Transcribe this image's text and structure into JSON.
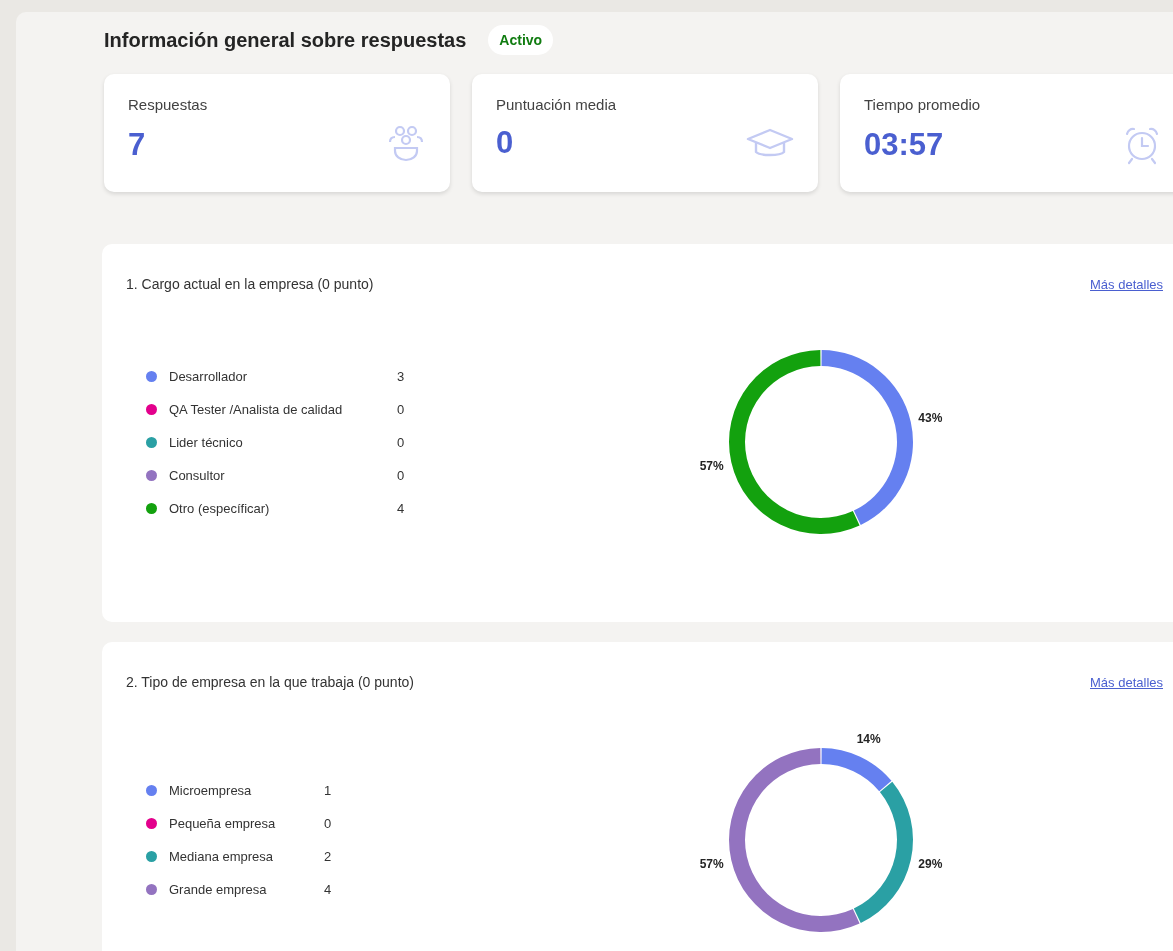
{
  "header": {
    "title": "Información general sobre respuestas",
    "status": "Activo"
  },
  "stats": [
    {
      "kind": "people",
      "label": "Respuestas",
      "value": "7"
    },
    {
      "kind": "cap",
      "label": "Puntuación media",
      "value": "0"
    },
    {
      "kind": "clock",
      "label": "Tiempo promedio",
      "value": "03:57"
    }
  ],
  "questions": [
    {
      "title": "1. Cargo actual en la empresa (0 punto)",
      "link": "Más detalles",
      "options": [
        {
          "count": "3",
          "color": "#6580f0"
        },
        {
          "count": "0",
          "color": "#e3008c"
        },
        {
          "count": "0",
          "color": "#2aa0a4"
        },
        {
          "count": "0",
          "color": "#9373c0"
        },
        {
          "count": "4",
          "color": "#13a10e"
        }
      ],
      "chart_data": {
        "type": "donut",
        "categories": [
          "Desarrollador",
          "QA Tester /Analista de calidad",
          "Lider técnico",
          "Consultor",
          "Otro (específicar)"
        ],
        "values": [
          43,
          0,
          0,
          0,
          57
        ],
        "value_labels": [
          "43%",
          null,
          null,
          null,
          "57%"
        ]
      }
    },
    {
      "title": "2. Tipo de empresa en la que trabaja (0 punto)",
      "link": "Más detalles",
      "options": [
        {
          "count": "1",
          "color": "#6580f0"
        },
        {
          "count": "0",
          "color": "#e3008c"
        },
        {
          "count": "2",
          "color": "#2aa0a4"
        },
        {
          "count": "4",
          "color": "#9373c0"
        }
      ],
      "chart_data": {
        "type": "donut",
        "categories": [
          "Microempresa",
          "Pequeña empresa",
          "Mediana empresa",
          "Grande empresa"
        ],
        "values": [
          14,
          0,
          29,
          57
        ],
        "value_labels": [
          "14%",
          null,
          "29%",
          "57%"
        ]
      }
    }
  ]
}
